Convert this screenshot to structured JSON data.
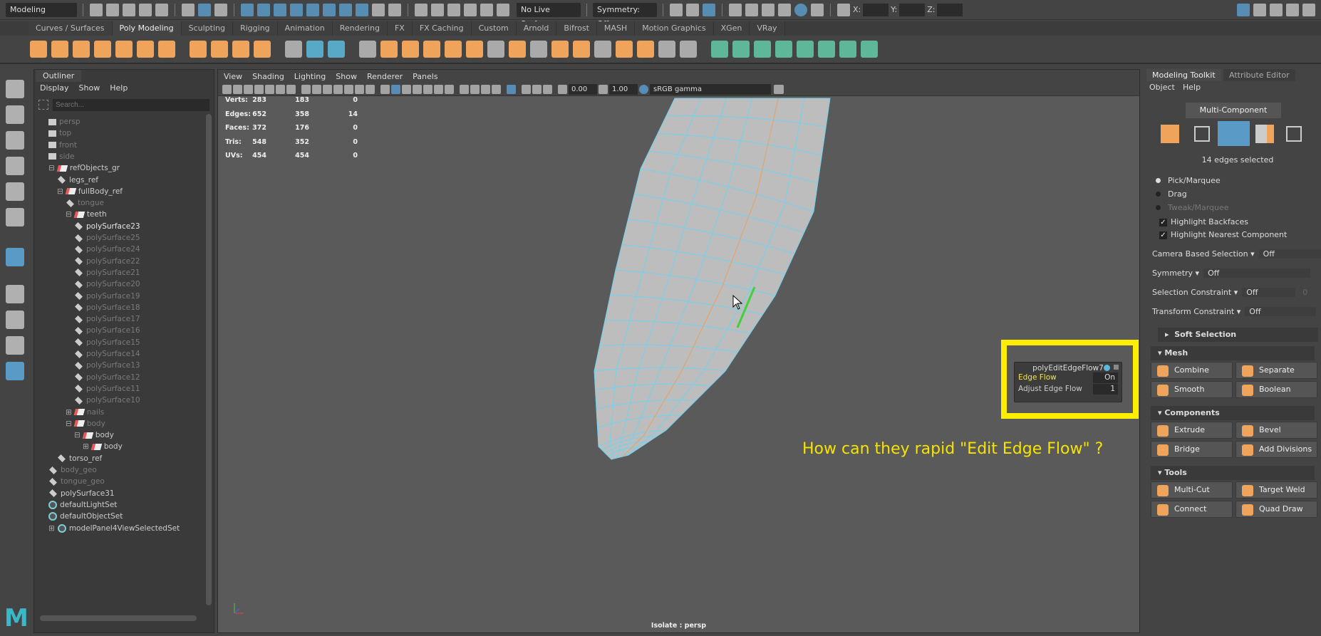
{
  "statusline": {
    "mode": "Modeling",
    "live_surface": "No Live Surface",
    "symmetry": "Symmetry: Off",
    "x_label": "X:",
    "y_label": "Y:",
    "z_label": "Z:"
  },
  "shelf": {
    "tabs": [
      "Curves / Surfaces",
      "Poly Modeling",
      "Sculpting",
      "Rigging",
      "Animation",
      "Rendering",
      "FX",
      "FX Caching",
      "Custom",
      "Arnold",
      "Bifrost",
      "MASH",
      "Motion Graphics",
      "XGen",
      "VRay"
    ],
    "active_tab": "Poly Modeling",
    "icons": [
      [
        "sphere",
        "orange"
      ],
      [
        "cube",
        "orange"
      ],
      [
        "cylinder",
        "orange"
      ],
      [
        "cone",
        "orange"
      ],
      [
        "torus",
        "orange"
      ],
      [
        "plane",
        "orange"
      ],
      [
        "disc",
        "orange"
      ],
      [
        "platonic",
        "orange"
      ],
      [
        "superellipse",
        "orange"
      ],
      [
        "type",
        "orange"
      ],
      [
        "svg",
        "orange"
      ],
      [
        "measure",
        "gray"
      ],
      [
        "snap-pivot",
        "blue"
      ],
      [
        "center-pivot",
        "blue"
      ],
      [
        "combine",
        "gray"
      ],
      [
        "separate",
        "orange"
      ],
      [
        "extract",
        "orange"
      ],
      [
        "smooth",
        "orange"
      ],
      [
        "boolean",
        "orange"
      ],
      [
        "extrude",
        "orange"
      ],
      [
        "bridge",
        "gray"
      ],
      [
        "bevel",
        "orange"
      ],
      [
        "add-divisions",
        "gray"
      ],
      [
        "fill-hole",
        "orange"
      ],
      [
        "make-hole",
        "orange"
      ],
      [
        "mirror",
        "gray"
      ],
      [
        "wedge",
        "orange"
      ],
      [
        "multi-cut",
        "orange"
      ],
      [
        "target-weld",
        "gray"
      ],
      [
        "quad-draw",
        "gray"
      ],
      [
        "uv-planar",
        "teal"
      ],
      [
        "uv-cylindrical",
        "teal"
      ],
      [
        "uv-spherical",
        "teal"
      ],
      [
        "uv-automatic",
        "teal"
      ],
      [
        "uv-contour",
        "teal"
      ],
      [
        "uv-editor",
        "teal"
      ],
      [
        "uv-unfold",
        "teal"
      ],
      [
        "uv-cut",
        "teal"
      ]
    ]
  },
  "outliner": {
    "tab": "Outliner",
    "menu": [
      "Display",
      "Show",
      "Help"
    ],
    "search_placeholder": "Search...",
    "items": [
      {
        "label": "persp",
        "icon": "cam",
        "level": 1,
        "style": "dim"
      },
      {
        "label": "top",
        "icon": "cam",
        "level": 1,
        "style": "dim"
      },
      {
        "label": "front",
        "icon": "cam",
        "level": 1,
        "style": "dim"
      },
      {
        "label": "side",
        "icon": "cam",
        "level": 1,
        "style": "dim"
      },
      {
        "label": "refObjects_gr",
        "icon": "group",
        "level": 1,
        "style": "normal",
        "expand": "-"
      },
      {
        "label": "legs_ref",
        "icon": "mesh",
        "level": 2,
        "style": "normal"
      },
      {
        "label": "fullBody_ref",
        "icon": "group",
        "level": 2,
        "style": "normal",
        "expand": "-"
      },
      {
        "label": "tongue",
        "icon": "mesh",
        "level": 3,
        "style": "dim"
      },
      {
        "label": "teeth",
        "icon": "group",
        "level": 3,
        "style": "normal",
        "expand": "-"
      },
      {
        "label": "polySurface23",
        "icon": "mesh",
        "level": 4,
        "style": "bright"
      },
      {
        "label": "polySurface25",
        "icon": "mesh",
        "level": 4,
        "style": "dim"
      },
      {
        "label": "polySurface24",
        "icon": "mesh",
        "level": 4,
        "style": "dim"
      },
      {
        "label": "polySurface22",
        "icon": "mesh",
        "level": 4,
        "style": "dim"
      },
      {
        "label": "polySurface21",
        "icon": "mesh",
        "level": 4,
        "style": "dim"
      },
      {
        "label": "polySurface20",
        "icon": "mesh",
        "level": 4,
        "style": "dim"
      },
      {
        "label": "polySurface19",
        "icon": "mesh",
        "level": 4,
        "style": "dim"
      },
      {
        "label": "polySurface18",
        "icon": "mesh",
        "level": 4,
        "style": "dim"
      },
      {
        "label": "polySurface17",
        "icon": "mesh",
        "level": 4,
        "style": "dim"
      },
      {
        "label": "polySurface16",
        "icon": "mesh",
        "level": 4,
        "style": "dim"
      },
      {
        "label": "polySurface15",
        "icon": "mesh",
        "level": 4,
        "style": "dim"
      },
      {
        "label": "polySurface14",
        "icon": "mesh",
        "level": 4,
        "style": "dim"
      },
      {
        "label": "polySurface13",
        "icon": "mesh",
        "level": 4,
        "style": "dim"
      },
      {
        "label": "polySurface12",
        "icon": "mesh",
        "level": 4,
        "style": "dim"
      },
      {
        "label": "polySurface11",
        "icon": "mesh",
        "level": 4,
        "style": "dim"
      },
      {
        "label": "polySurface10",
        "icon": "mesh",
        "level": 4,
        "style": "dim"
      },
      {
        "label": "nails",
        "icon": "group",
        "level": 3,
        "style": "dim",
        "expand": "+"
      },
      {
        "label": "body",
        "icon": "group",
        "level": 3,
        "style": "dim",
        "expand": "-"
      },
      {
        "label": "body",
        "icon": "group",
        "level": 4,
        "style": "normal",
        "expand": "-"
      },
      {
        "label": "body",
        "icon": "group",
        "level": 5,
        "style": "normal",
        "expand": "+"
      },
      {
        "label": "torso_ref",
        "icon": "mesh",
        "level": 2,
        "style": "normal"
      },
      {
        "label": "body_geo",
        "icon": "mesh",
        "level": 1,
        "style": "dim"
      },
      {
        "label": "tongue_geo",
        "icon": "mesh",
        "level": 1,
        "style": "dim"
      },
      {
        "label": "polySurface31",
        "icon": "mesh",
        "level": 1,
        "style": "normal"
      },
      {
        "label": "defaultLightSet",
        "icon": "set",
        "level": 1,
        "style": "normal"
      },
      {
        "label": "defaultObjectSet",
        "icon": "set",
        "level": 1,
        "style": "normal"
      },
      {
        "label": "modelPanel4ViewSelectedSet",
        "icon": "set",
        "level": 1,
        "style": "normal",
        "expand": "+"
      }
    ]
  },
  "viewport": {
    "menu": [
      "View",
      "Shading",
      "Lighting",
      "Show",
      "Renderer",
      "Panels"
    ],
    "exposure": "0.00",
    "gamma": "1.00",
    "color_space": "sRGB gamma",
    "hud": {
      "rows": [
        [
          "Verts:",
          "283",
          "183",
          "0"
        ],
        [
          "Edges:",
          "652",
          "358",
          "14"
        ],
        [
          "Faces:",
          "372",
          "176",
          "0"
        ],
        [
          "Tris:",
          "548",
          "352",
          "0"
        ],
        [
          "UVs:",
          "454",
          "454",
          "0"
        ]
      ]
    },
    "isolate": "Isolate : persp",
    "popup": {
      "title": "polyEditEdgeFlow7",
      "rows": [
        {
          "label": "Edge Flow",
          "value": "On"
        },
        {
          "label": "Adjust Edge Flow",
          "value": "1"
        }
      ]
    },
    "annotation": "How can they rapid \"Edit Edge Flow\" ?",
    "colors": {
      "wire": "#6fd3f0",
      "selected_edge": "#3ed23e",
      "highlight": "#ffee00"
    }
  },
  "right_panel": {
    "tabs": [
      "Modeling Toolkit",
      "Attribute Editor"
    ],
    "menu": [
      "Object",
      "Help"
    ],
    "multi_component": "Multi-Component",
    "selection_count": "14 edges selected",
    "modes": [
      "Pick/Marquee",
      "Drag",
      "Tweak/Marquee"
    ],
    "checks": [
      "Highlight Backfaces",
      "Highlight Nearest Component"
    ],
    "settings": [
      {
        "label": "Camera Based Selection",
        "value": "Off"
      },
      {
        "label": "Symmetry",
        "value": "Off"
      },
      {
        "label": "Selection Constraint",
        "value": "Off",
        "extra": "0"
      },
      {
        "label": "Transform Constraint",
        "value": "Off"
      }
    ],
    "soft_selection": "Soft Selection",
    "sections": [
      {
        "title": "Mesh",
        "buttons": [
          "Combine",
          "Separate",
          "Smooth",
          "Boolean"
        ]
      },
      {
        "title": "Components",
        "buttons": [
          "Extrude",
          "Bevel",
          "Bridge",
          "Add Divisions"
        ]
      },
      {
        "title": "Tools",
        "buttons": [
          "Multi-Cut",
          "Target Weld",
          "Connect",
          "Quad Draw"
        ]
      }
    ]
  }
}
